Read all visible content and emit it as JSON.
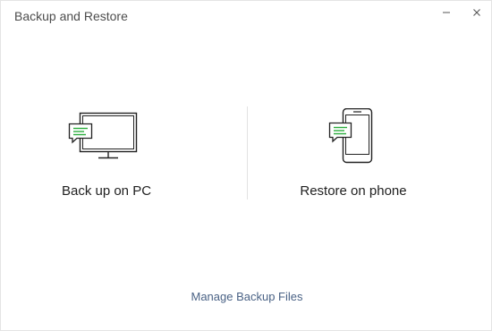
{
  "window": {
    "title": "Backup and Restore",
    "minimize_icon": "minimize-icon",
    "close_icon": "close-icon"
  },
  "options": {
    "backup_pc": {
      "label": "Back up on PC",
      "icon": "monitor-chat-icon"
    },
    "restore_phone": {
      "label": "Restore on phone",
      "icon": "phone-chat-icon"
    }
  },
  "footer": {
    "manage_link": "Manage Backup Files"
  },
  "colors": {
    "accent_green": "#2bad3d",
    "link": "#4a6285",
    "text": "#1f1f1f",
    "title": "#4d4d4d"
  }
}
